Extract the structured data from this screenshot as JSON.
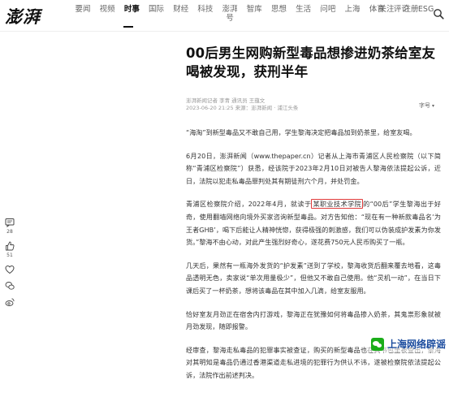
{
  "header": {
    "logo": "澎湃",
    "nav": [
      "要闻",
      "视频",
      "时事",
      "国际",
      "财经",
      "科技",
      "澎湃号",
      "智库",
      "思想",
      "生活",
      "问吧",
      "上海",
      "体育",
      "评论",
      "ESG"
    ],
    "active_nav": "时事",
    "right": [
      "关注",
      "注册"
    ]
  },
  "article": {
    "title": "00后男生网购新型毒品想掺进奶茶给室友喝被发现，获刑半年",
    "meta_source": "澎湃新闻记者 李青 通讯员 王蕴文",
    "meta_time": "2023-06-20 21:25 来源：澎湃新闻 · 浦江头条",
    "font_toggle": "字号",
    "paragraphs": [
      {
        "text": "“海淘”到新型毒品又不敢自己用，学生黎海决定把毒品加到奶茶里，给室友喝。"
      },
      {
        "text": "6月20日，澎湃新闻（www.thepaper.cn）记者从上海市青浦区人民检察院（以下简称“青浦区检察院”）获悉，经该院于2023年2月10日对被告人黎海依法提起公诉，近日，法院以犯走私毒品罪判处其有期徒刑六个月，并处罚金。"
      },
      {
        "before": "青浦区检察院介绍，2022年4月，就读于",
        "highlight": "某职业技术学院",
        "after": "的“00后”学生黎海出于好奇，使用翻墙网络向境外买家咨询新型毒品。对方告知他：“现在有一种新款毒品名‘为王者GHB’，喝下后能让人精神恍惚，获得极强的刺激感，我们可以伪装成护发素为你发货。”黎海不由心动，对此产生强烈好奇心，遂花费750元人民币购买了一瓶。"
      },
      {
        "text": "几天后，果然有一瓶海外发货的“护发素”送到了学校，黎海收货后翻来覆去地看，这毒品透明无色，卖家说“单次用量极少”，但他又不敢自己使用。他“灵机一动”，在当日下课后买了一杯奶茶，想将该毒品在其中加入几滴，给室友服用。"
      },
      {
        "text": "恰好室友月劲正在宿舍内打游戏，黎海正在犹豫如何将毒品掺入奶茶，其鬼祟形象就被月劲发现，随即报警。"
      },
      {
        "text": "经审查，黎海走私毒品的犯罪事实被查证，购买的新型毒品也在其书包里被查出，黎海对其明知是毒品仍通过香港渠道走私进境的犯罪行为供认不讳，遂被检察院依法提起公诉，法院作出前述判决。"
      }
    ]
  },
  "actions": [
    {
      "icon": "comment-icon",
      "count": "28"
    },
    {
      "icon": "like-icon",
      "count": "51"
    },
    {
      "icon": "heart-icon",
      "count": ""
    },
    {
      "icon": "wechat-icon",
      "count": ""
    },
    {
      "icon": "weibo-icon",
      "count": ""
    }
  ],
  "watermark": {
    "text": "上海网络辟谣"
  },
  "colors": {
    "highlight_border": "#e03a3a",
    "active_nav": "#111111",
    "watermark": "#1a4b9e"
  }
}
